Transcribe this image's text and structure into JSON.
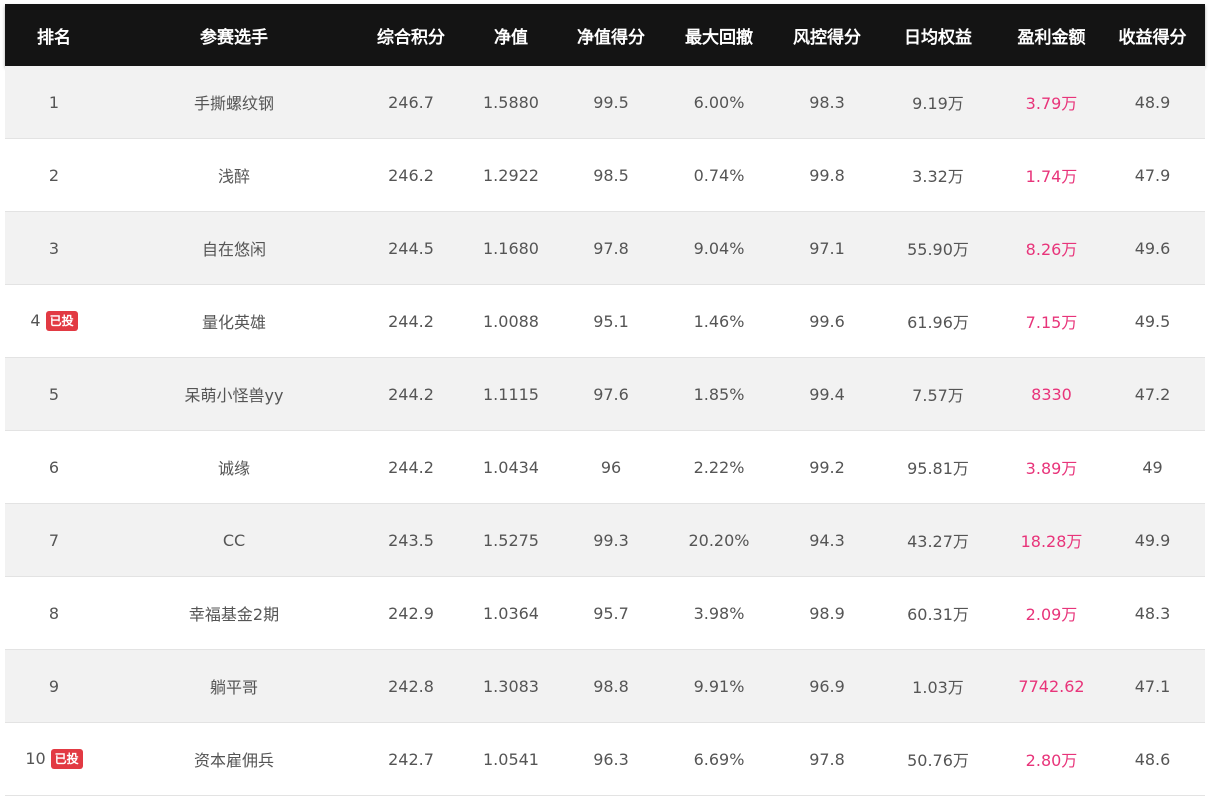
{
  "table": {
    "headers": {
      "rank": "排名",
      "name": "参赛选手",
      "score": "综合积分",
      "nav": "净值",
      "nav_score": "净值得分",
      "max_drawdown": "最大回撤",
      "risk_score": "风控得分",
      "daily_equity": "日均权益",
      "profit": "盈利金额",
      "return_score": "收益得分"
    },
    "rows": [
      {
        "rank": "1",
        "badge": "",
        "name": "手撕螺纹钢",
        "score": "246.7",
        "nav": "1.5880",
        "nav_score": "99.5",
        "max_drawdown": "6.00%",
        "risk_score": "98.3",
        "daily_equity": "9.19万",
        "profit": "3.79万",
        "return_score": "48.9"
      },
      {
        "rank": "2",
        "badge": "",
        "name": "浅醉",
        "score": "246.2",
        "nav": "1.2922",
        "nav_score": "98.5",
        "max_drawdown": "0.74%",
        "risk_score": "99.8",
        "daily_equity": "3.32万",
        "profit": "1.74万",
        "return_score": "47.9"
      },
      {
        "rank": "3",
        "badge": "",
        "name": "自在悠闲",
        "score": "244.5",
        "nav": "1.1680",
        "nav_score": "97.8",
        "max_drawdown": "9.04%",
        "risk_score": "97.1",
        "daily_equity": "55.90万",
        "profit": "8.26万",
        "return_score": "49.6"
      },
      {
        "rank": "4",
        "badge": "已投",
        "name": "量化英雄",
        "score": "244.2",
        "nav": "1.0088",
        "nav_score": "95.1",
        "max_drawdown": "1.46%",
        "risk_score": "99.6",
        "daily_equity": "61.96万",
        "profit": "7.15万",
        "return_score": "49.5"
      },
      {
        "rank": "5",
        "badge": "",
        "name": "呆萌小怪兽yy",
        "score": "244.2",
        "nav": "1.1115",
        "nav_score": "97.6",
        "max_drawdown": "1.85%",
        "risk_score": "99.4",
        "daily_equity": "7.57万",
        "profit": "8330",
        "return_score": "47.2"
      },
      {
        "rank": "6",
        "badge": "",
        "name": "诚缘",
        "score": "244.2",
        "nav": "1.0434",
        "nav_score": "96",
        "max_drawdown": "2.22%",
        "risk_score": "99.2",
        "daily_equity": "95.81万",
        "profit": "3.89万",
        "return_score": "49"
      },
      {
        "rank": "7",
        "badge": "",
        "name": "CC",
        "score": "243.5",
        "nav": "1.5275",
        "nav_score": "99.3",
        "max_drawdown": "20.20%",
        "risk_score": "94.3",
        "daily_equity": "43.27万",
        "profit": "18.28万",
        "return_score": "49.9"
      },
      {
        "rank": "8",
        "badge": "",
        "name": "幸福基金2期",
        "score": "242.9",
        "nav": "1.0364",
        "nav_score": "95.7",
        "max_drawdown": "3.98%",
        "risk_score": "98.9",
        "daily_equity": "60.31万",
        "profit": "2.09万",
        "return_score": "48.3"
      },
      {
        "rank": "9",
        "badge": "",
        "name": "躺平哥",
        "score": "242.8",
        "nav": "1.3083",
        "nav_score": "98.8",
        "max_drawdown": "9.91%",
        "risk_score": "96.9",
        "daily_equity": "1.03万",
        "profit": "7742.62",
        "return_score": "47.1"
      },
      {
        "rank": "10",
        "badge": "已投",
        "name": "资本雇佣兵",
        "score": "242.7",
        "nav": "1.0541",
        "nav_score": "96.3",
        "max_drawdown": "6.69%",
        "risk_score": "97.8",
        "daily_equity": "50.76万",
        "profit": "2.80万",
        "return_score": "48.6"
      }
    ]
  },
  "colors": {
    "header_bg": "#141414",
    "header_text": "#ffffff",
    "row_odd": "#f2f2f2",
    "row_even": "#ffffff",
    "profit": "#e8347a",
    "badge": "#e23a43"
  }
}
